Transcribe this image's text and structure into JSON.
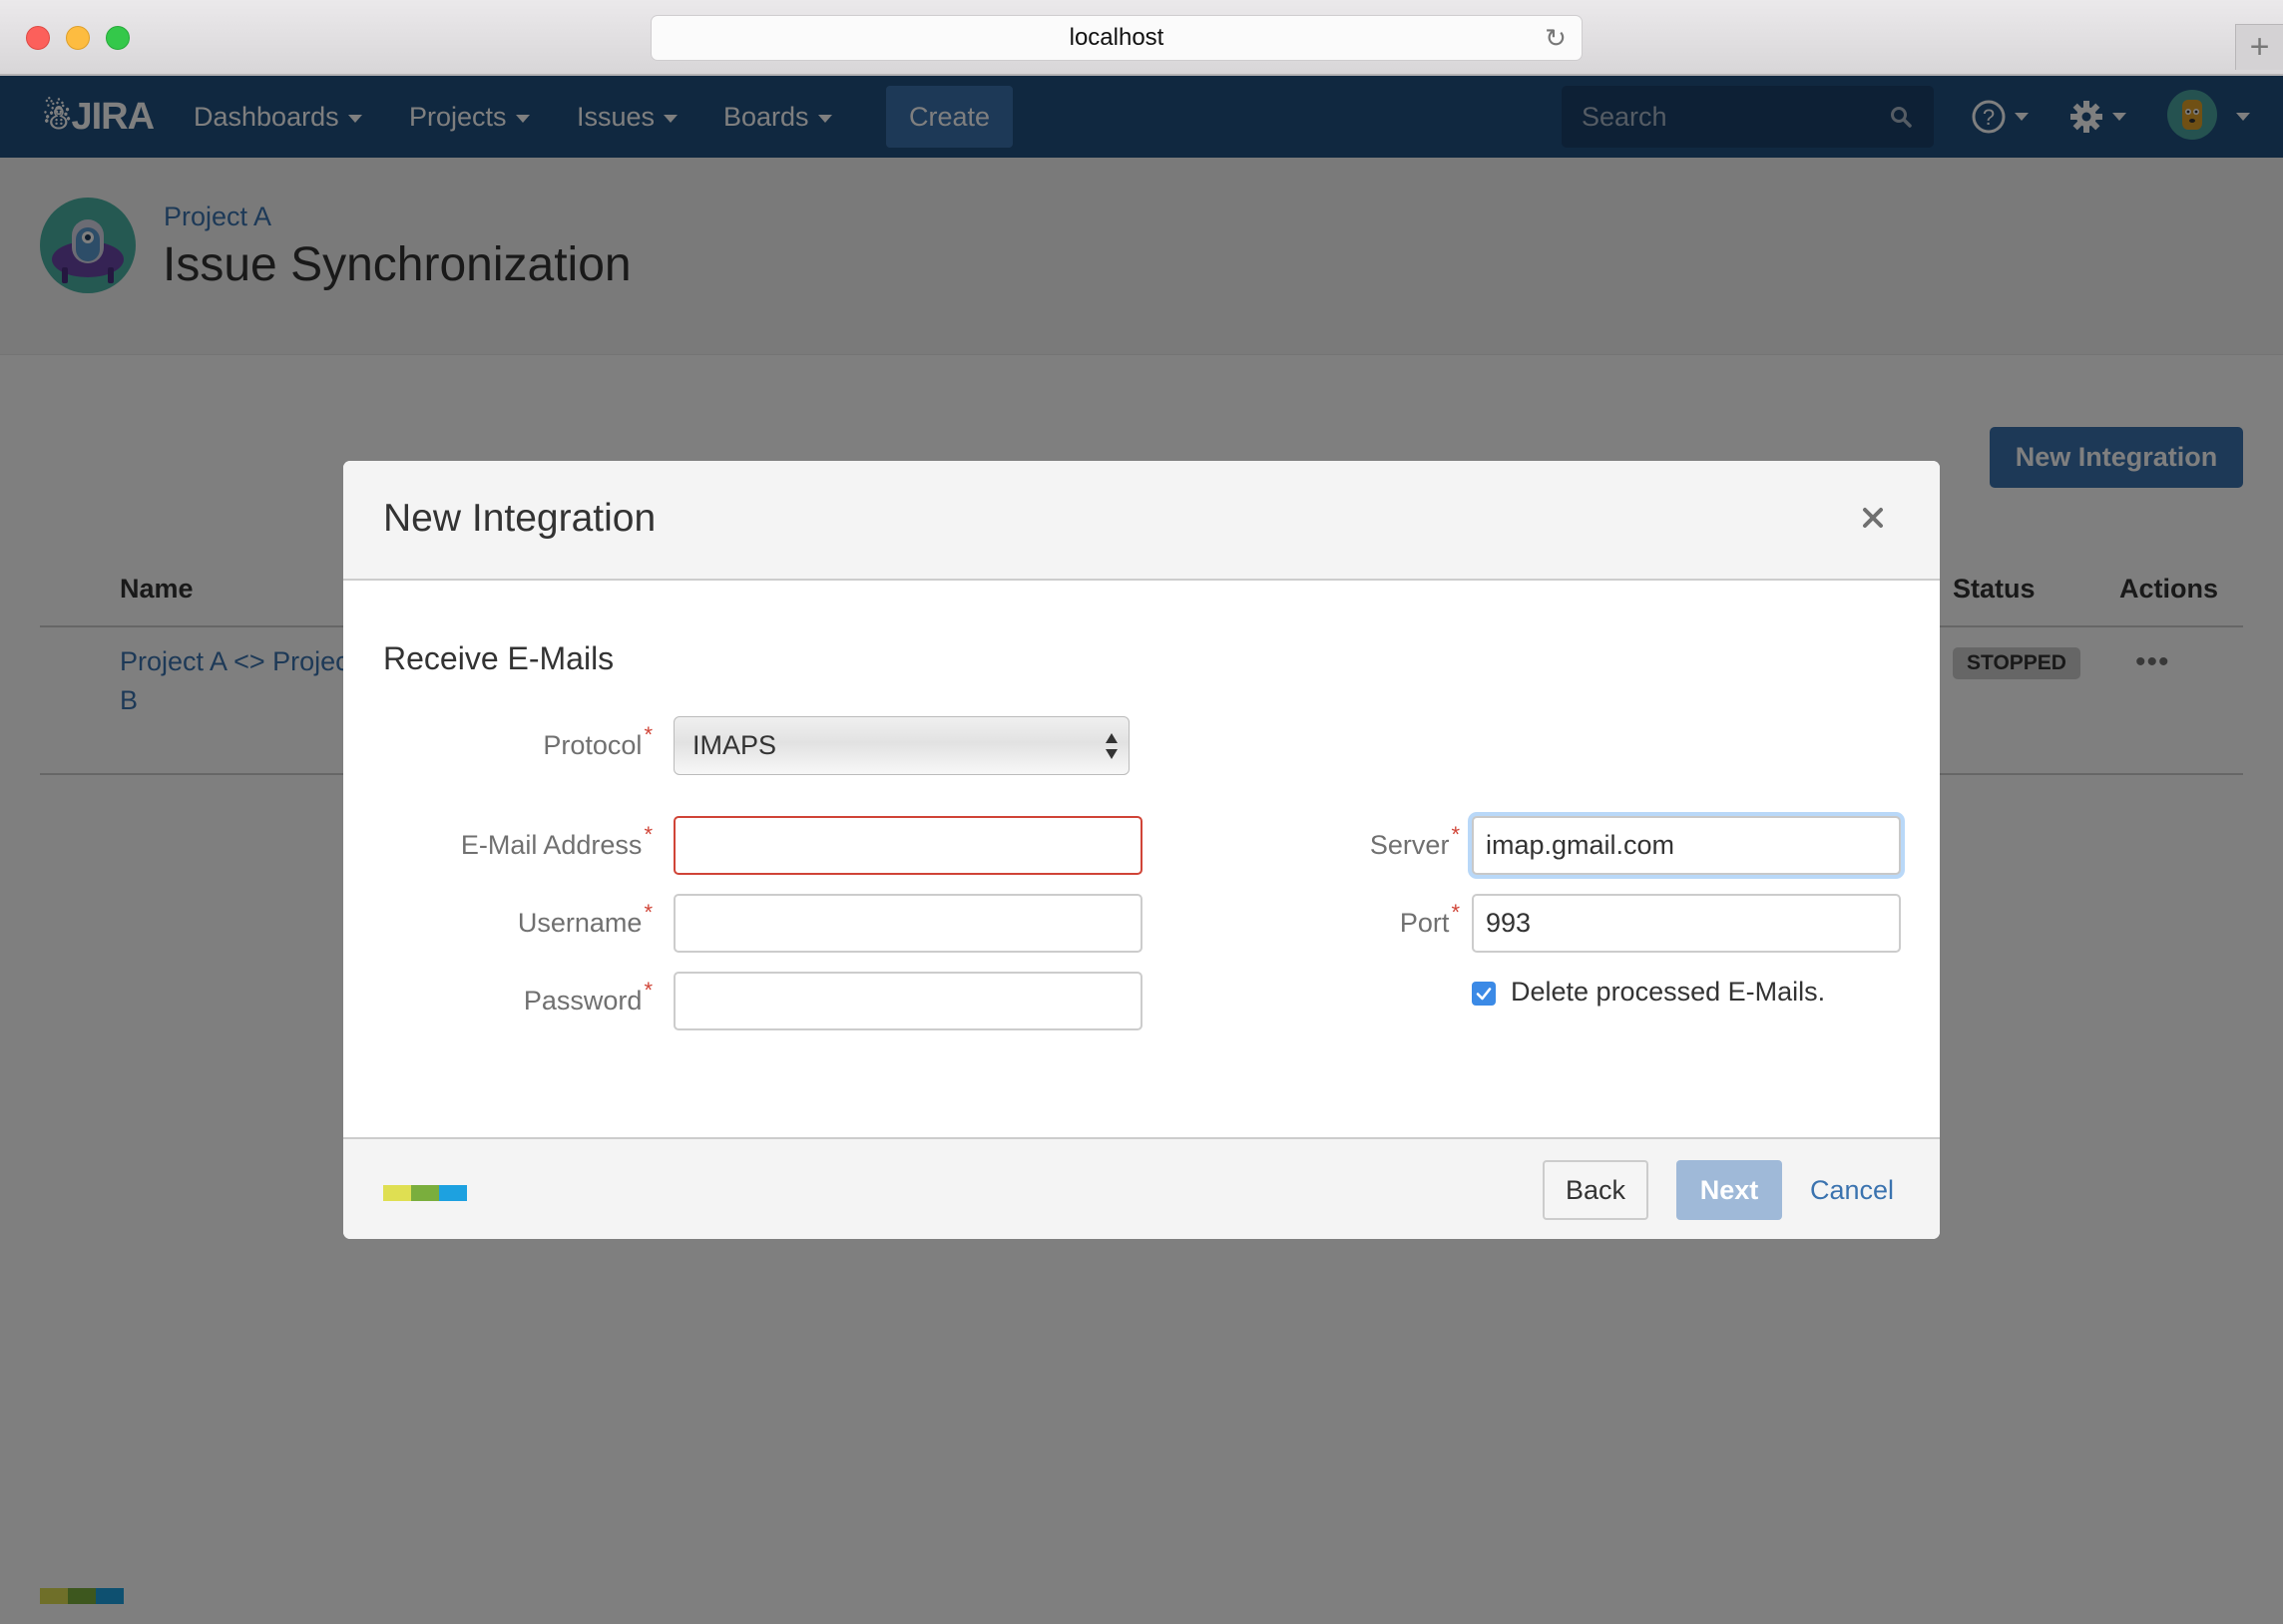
{
  "browser": {
    "url": "localhost",
    "reload_icon": "reload-icon",
    "new_tab_label": "+"
  },
  "nav": {
    "logo": "JIRA",
    "items": [
      {
        "label": "Dashboards"
      },
      {
        "label": "Projects"
      },
      {
        "label": "Issues"
      },
      {
        "label": "Boards"
      }
    ],
    "create_label": "Create",
    "search_placeholder": "Search",
    "help_icon": "help-icon",
    "settings_icon": "gear-icon",
    "avatar": "user-avatar"
  },
  "page": {
    "breadcrumb": "Project A",
    "title": "Issue Synchronization",
    "new_integration_label": "New Integration",
    "table": {
      "headers": {
        "name": "Name",
        "status": "Status",
        "actions": "Actions"
      },
      "rows": [
        {
          "name": "Project A <> Project B",
          "status": "STOPPED",
          "actions": "•••"
        }
      ]
    },
    "footer_logo_colors": [
      "#6e7230",
      "#3e5b22",
      "#0e5878"
    ]
  },
  "modal": {
    "title": "New Integration",
    "close_label": "×",
    "section_title": "Receive E-Mails",
    "fields": {
      "protocol": {
        "label": "Protocol",
        "value": "IMAPS",
        "required": "*"
      },
      "email": {
        "label": "E-Mail Address",
        "value": "",
        "placeholder": "",
        "required": "*"
      },
      "username": {
        "label": "Username",
        "value": "",
        "placeholder": "",
        "required": "*"
      },
      "password": {
        "label": "Password",
        "value": "",
        "placeholder": "",
        "required": "*"
      },
      "server": {
        "label": "Server",
        "value": "imap.gmail.com",
        "required": "*"
      },
      "port": {
        "label": "Port",
        "value": "993",
        "required": "*"
      }
    },
    "delete_checkbox": {
      "label": "Delete processed E-Mails.",
      "checked": true
    },
    "footer": {
      "back_label": "Back",
      "next_label": "Next",
      "cancel_label": "Cancel",
      "logo_colors": [
        "#dfdf52",
        "#7aae3d",
        "#1da1e0"
      ]
    }
  },
  "colors": {
    "nav_bg": "#205081",
    "link": "#3b73af",
    "error": "#d04437",
    "checkbox": "#3b8ae6"
  }
}
